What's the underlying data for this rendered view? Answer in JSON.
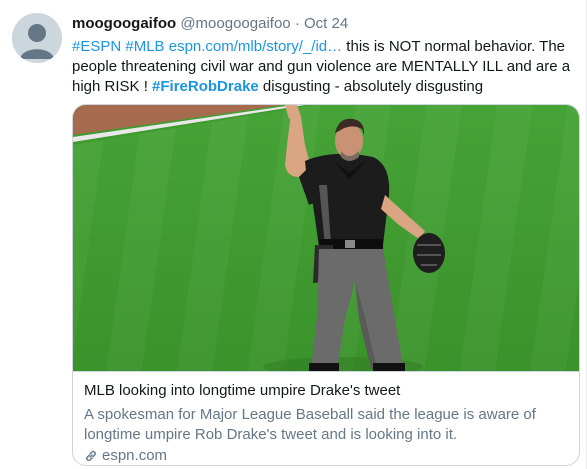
{
  "tweet": {
    "display_name": "moogoogaifoo",
    "handle": "@moogoogaifoo",
    "separator": "·",
    "date": "Oct 24",
    "text_parts": {
      "hashtag_espn": "#ESPN",
      "hashtag_mlb": "#MLB",
      "url": "espn.com/mlb/story/_/id…",
      "text_1": " this is NOT normal behavior. The people threatening civil war and gun violence are MENTALLY ILL and are a high RISK !  ",
      "hashtag_firerobdrake": "#FireRobDrake",
      "text_2": "  disgusting - absolutely disgusting"
    }
  },
  "card": {
    "title": "MLB looking into longtime umpire Drake's tweet",
    "description": "A spokesman for Major League Baseball said the league is aware of longtime umpire Rob Drake's tweet and is looking into it.",
    "domain": "espn.com",
    "link_icon": "link-icon"
  },
  "colors": {
    "link_blue": "#1b95e0",
    "secondary_text": "#657786",
    "border": "#ccd6dd",
    "grass_green": "#3f9a2f"
  }
}
